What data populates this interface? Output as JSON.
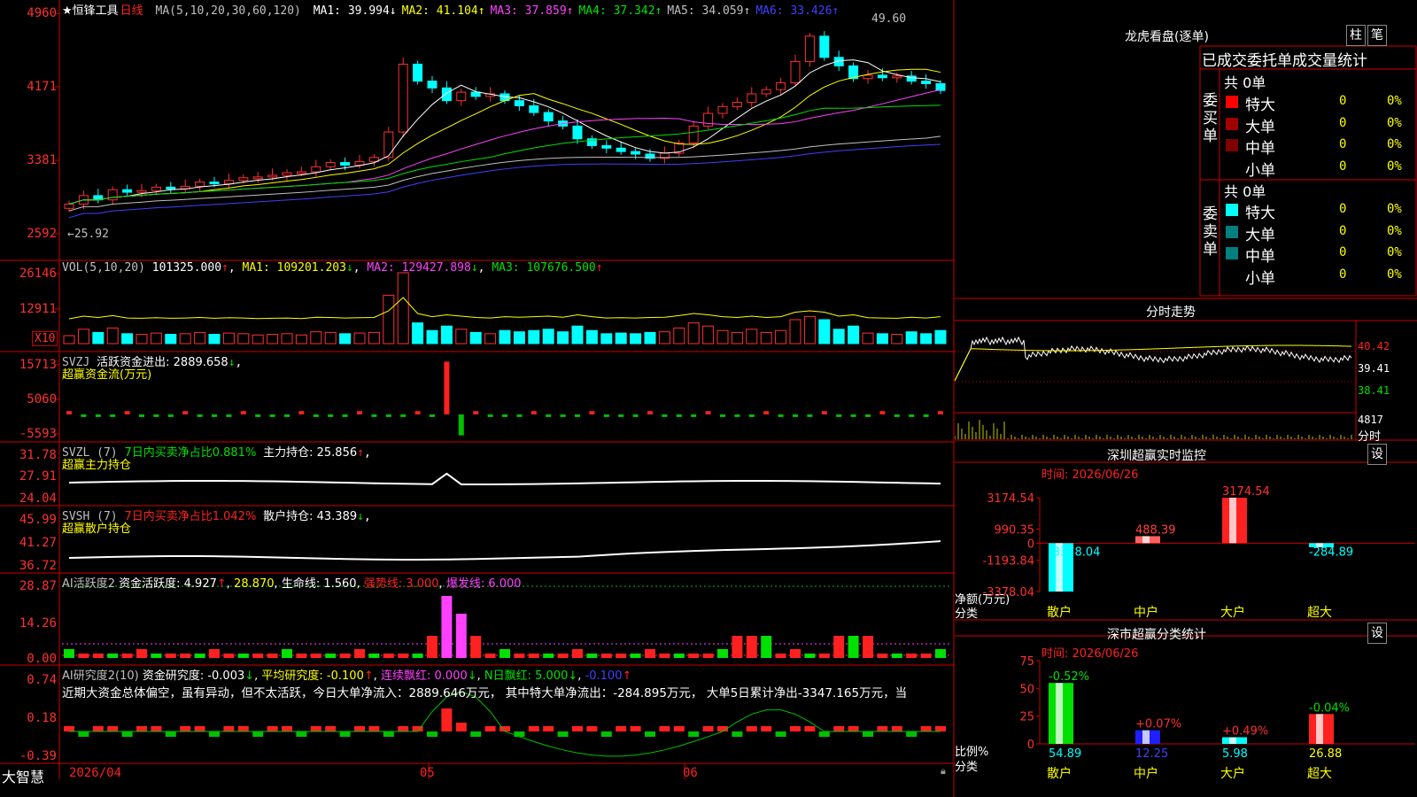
{
  "app": {
    "title": "★恒锋工具",
    "period": "日线",
    "bottom_left": "大智慧",
    "date_axis": [
      "2026/04",
      "05",
      "06"
    ]
  },
  "main_chart": {
    "ma_label": "MA(5,10,20,30,60,120)",
    "ma": [
      {
        "name": "MA1",
        "value": "39.994",
        "dir": "↓",
        "color": "#ffffff"
      },
      {
        "name": "MA2",
        "value": "41.104",
        "dir": "↑",
        "color": "#ffff00"
      },
      {
        "name": "MA3",
        "value": "37.859",
        "dir": "↑",
        "color": "#ff40ff"
      },
      {
        "name": "MA4",
        "value": "37.342",
        "dir": "↑",
        "color": "#00e000"
      },
      {
        "name": "MA5",
        "value": "34.059",
        "dir": "↑",
        "color": "#c0c0c0"
      },
      {
        "name": "MA6",
        "value": "33.426",
        "dir": "↑",
        "color": "#4040ff"
      }
    ],
    "y_ticks": [
      "4960",
      "4171",
      "3381",
      "2592"
    ],
    "high_label": "49.60",
    "low_label": "←25.92"
  },
  "vol": {
    "label": "VOL(5,10,20)",
    "value": "101325.000",
    "value_dir": "↑",
    "ma1": "109201.203",
    "ma1_dir": "↓",
    "ma2": "129427.898",
    "ma2_dir": "↓",
    "ma3": "107676.500",
    "ma3_dir": "↑",
    "y_ticks": [
      "26146",
      "12911"
    ],
    "unit": "X10"
  },
  "svzj": {
    "label": "SVZJ",
    "text": "活跃资金进出: 2889.658",
    "dir": "↓",
    "subtitle": "超赢资金流(万元)",
    "y_ticks": [
      "15713",
      "5060",
      "-5593"
    ]
  },
  "svzl": {
    "label": "SVZL (7)",
    "text1": "7日内买卖净占比0.881%",
    "text2": "主力持仓: 25.856",
    "dir": "↑",
    "subtitle": "超赢主力持仓",
    "y_ticks": [
      "31.78",
      "27.91",
      "24.04"
    ]
  },
  "svsh": {
    "label": "SVSH (7)",
    "text1": "7日内买卖净占比1.042%",
    "text2": "散户持仓: 43.389",
    "dir": "↓",
    "subtitle": "超赢散户持仓",
    "y_ticks": [
      "45.99",
      "41.27",
      "36.72"
    ]
  },
  "ai1": {
    "label": "AI活跃度2",
    "t1": "资金活跃度: 4.927",
    "t1_dir": "↑",
    "t2": "28.870",
    "t3": "生命线: 1.560",
    "t4": "强势线: 3.000",
    "t5": "爆发线: 6.000",
    "y_ticks": [
      "28.87",
      "14.26",
      "0.00"
    ]
  },
  "ai2": {
    "label": "AI研究度2(10)",
    "t1": "资金研究度: -0.003",
    "t1_dir": "↓",
    "t2": "平均研究度: -0.100",
    "t2_dir": "↑",
    "t3": "连续飘红: 0.000",
    "t3_dir": "↓",
    "t4": "N日飘红: 5.000",
    "t4_dir": "↓",
    "t5": "-0.100",
    "t5_dir": "↑",
    "summary": "近期大资金总体偏空，虽有异动，但不太活跃，今日大单净流入：2889.646万元， 其中特大单净流出：-284.895万元， 大单5日累计净出-3347.165万元，当",
    "y_ticks": [
      "0.74",
      "0.18",
      "-0.39"
    ]
  },
  "right": {
    "lhb_title": "龙虎看盘(逐单)",
    "btn_zhu": "柱",
    "btn_bi": "笔",
    "stats_title": "已成交委托单成交量统计",
    "buy_label": "委买单",
    "sell_label": "委卖单",
    "buy_total": "共 0单",
    "sell_total": "共 0单",
    "buy_rows": [
      {
        "name": "特大",
        "count": "0",
        "pct": "0%",
        "color": "#ff0000"
      },
      {
        "name": "大单",
        "count": "0",
        "pct": "0%",
        "color": "#a00000"
      },
      {
        "name": "中单",
        "count": "0",
        "pct": "0%",
        "color": "#800000"
      },
      {
        "name": "小单",
        "count": "0",
        "pct": "0%",
        "color": "#000000"
      }
    ],
    "sell_rows": [
      {
        "name": "特大",
        "count": "0",
        "pct": "0%",
        "color": "#00ffff"
      },
      {
        "name": "大单",
        "count": "0",
        "pct": "0%",
        "color": "#008080"
      },
      {
        "name": "中单",
        "count": "0",
        "pct": "0%",
        "color": "#008080"
      },
      {
        "name": "小单",
        "count": "0",
        "pct": "0%",
        "color": "#000000"
      }
    ],
    "fenshi_title": "分时走势",
    "fenshi_ticks": [
      "40.42",
      "39.41",
      "38.41"
    ],
    "fenshi_vol": "4817",
    "fenshi_vol_unit": "分时",
    "sz_title": "深圳超赢实时监控",
    "sz_btn": "设",
    "sz_time": "时间: 2026/06/26",
    "sz_ticks": [
      "3174.54",
      "990.35",
      "0",
      "-1193.84",
      "-3378.04"
    ],
    "sz_ylabel": "净额(万元)",
    "sz_xlabel": "分类",
    "sz_cats": [
      "散户",
      "中户",
      "大户",
      "超大"
    ],
    "sz_vals": [
      "-3378.04",
      "488.39",
      "3174.54",
      "-284.89"
    ],
    "fl_title": "深市超赢分类统计",
    "fl_btn": "设",
    "fl_time": "时间: 2026/06/26",
    "fl_ticks": [
      "75",
      "50",
      "25",
      "0"
    ],
    "fl_ylabel": "比例%",
    "fl_xlabel": "分类",
    "fl_cats": [
      "散户",
      "中户",
      "大户",
      "超大"
    ],
    "fl_vals": [
      "54.89",
      "12.25",
      "5.98",
      "26.88"
    ],
    "fl_changes": [
      "-0.52%",
      "+0.07%",
      "+0.49%",
      "-0.04%"
    ]
  },
  "chart_data": [
    {
      "type": "bar",
      "title": "深圳超赢实时监控",
      "ylabel": "净额(万元)",
      "xlabel": "分类",
      "categories": [
        "散户",
        "中户",
        "大户",
        "超大"
      ],
      "values": [
        -3378.04,
        488.39,
        3174.54,
        -284.89
      ],
      "ylim": [
        -3378.04,
        3174.54
      ]
    },
    {
      "type": "bar",
      "title": "深市超赢分类统计",
      "ylabel": "比例%",
      "xlabel": "分类",
      "categories": [
        "散户",
        "中户",
        "大户",
        "超大"
      ],
      "values": [
        54.89,
        12.25,
        5.98,
        26.88
      ],
      "ylim": [
        0,
        75
      ]
    }
  ]
}
